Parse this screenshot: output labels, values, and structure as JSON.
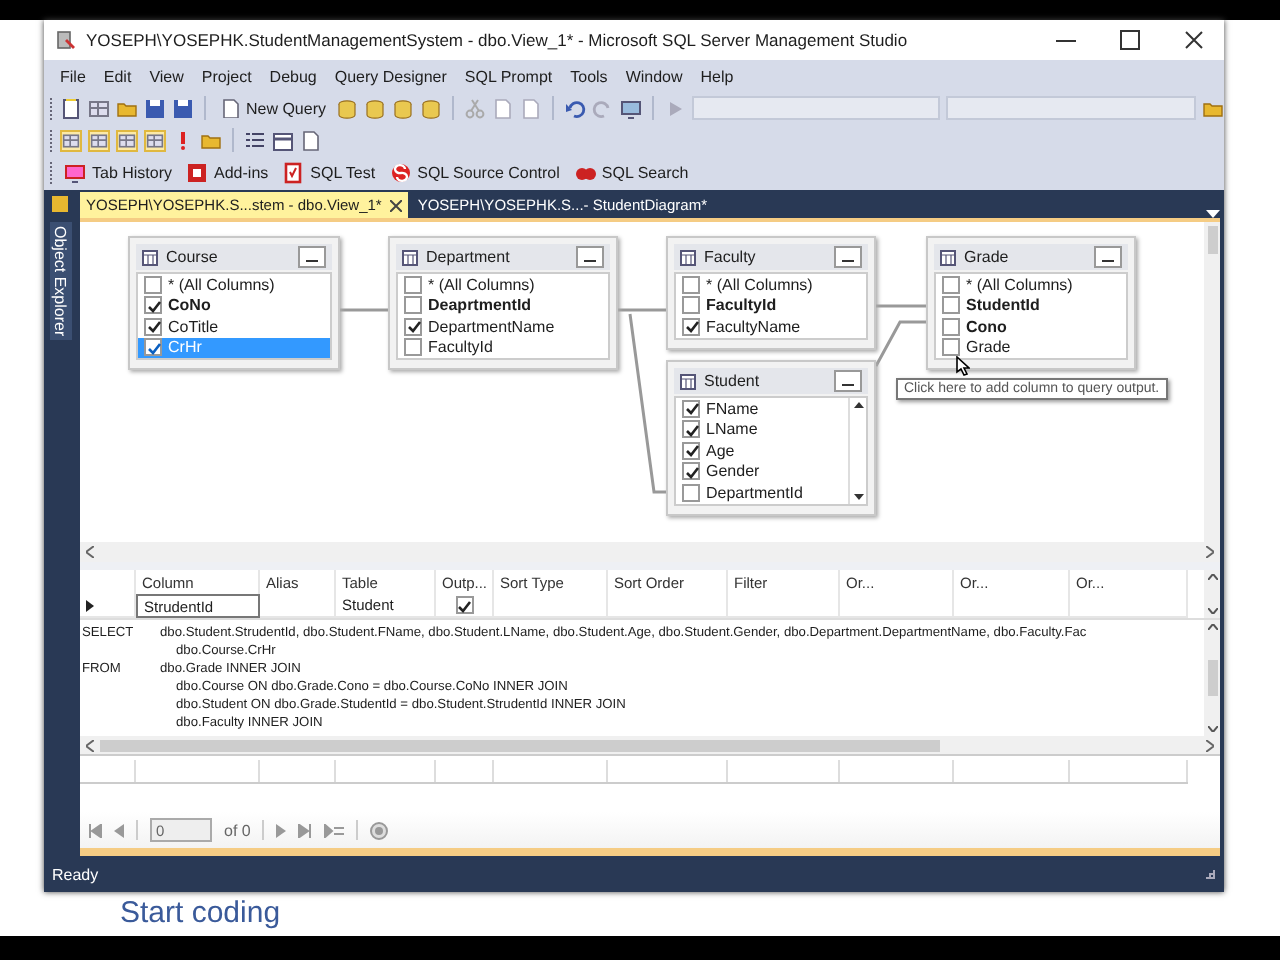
{
  "window": {
    "title": "YOSEPH\\YOSEPHK.StudentManagementSystem - dbo.View_1* - Microsoft SQL Server Management Studio"
  },
  "menu": [
    "File",
    "Edit",
    "View",
    "Project",
    "Debug",
    "Query Designer",
    "SQL Prompt",
    "Tools",
    "Window",
    "Help"
  ],
  "toolbar": {
    "new_query": "New Query"
  },
  "addin_toolbar": [
    "Tab History",
    "Add-ins",
    "SQL Test",
    "SQL Source Control",
    "SQL Search"
  ],
  "side_panel": {
    "label": "Object Explorer"
  },
  "tabs": [
    {
      "label": "YOSEPH\\YOSEPHK.S...stem - dbo.View_1*",
      "selected": true
    },
    {
      "label": "YOSEPH\\YOSEPHK.S...- StudentDiagram*",
      "selected": false
    }
  ],
  "diagram": {
    "tables": [
      {
        "name": "Course",
        "columns": [
          {
            "name": "* (All Columns)",
            "checked": false,
            "key": false,
            "selected": false
          },
          {
            "name": "CoNo",
            "checked": true,
            "key": true,
            "selected": false
          },
          {
            "name": "CoTitle",
            "checked": true,
            "key": false,
            "selected": false
          },
          {
            "name": "CrHr",
            "checked": true,
            "key": false,
            "selected": true
          }
        ]
      },
      {
        "name": "Department",
        "columns": [
          {
            "name": "* (All Columns)",
            "checked": false,
            "key": false,
            "selected": false
          },
          {
            "name": "DeaprtmentId",
            "checked": false,
            "key": true,
            "selected": false
          },
          {
            "name": "DepartmentName",
            "checked": true,
            "key": false,
            "selected": false
          },
          {
            "name": "FacultyId",
            "checked": false,
            "key": false,
            "selected": false
          }
        ]
      },
      {
        "name": "Faculty",
        "columns": [
          {
            "name": "* (All Columns)",
            "checked": false,
            "key": false,
            "selected": false
          },
          {
            "name": "FacultyId",
            "checked": false,
            "key": true,
            "selected": false
          },
          {
            "name": "FacultyName",
            "checked": true,
            "key": false,
            "selected": false
          }
        ]
      },
      {
        "name": "Student",
        "columns": [
          {
            "name": "FName",
            "checked": true,
            "key": false,
            "selected": false
          },
          {
            "name": "LName",
            "checked": true,
            "key": false,
            "selected": false
          },
          {
            "name": "Age",
            "checked": true,
            "key": false,
            "selected": false
          },
          {
            "name": "Gender",
            "checked": true,
            "key": false,
            "selected": false
          },
          {
            "name": "DepartmentId",
            "checked": false,
            "key": false,
            "selected": false
          }
        ]
      },
      {
        "name": "Grade",
        "columns": [
          {
            "name": "* (All Columns)",
            "checked": false,
            "key": false,
            "selected": false
          },
          {
            "name": "StudentId",
            "checked": false,
            "key": true,
            "selected": false
          },
          {
            "name": "Cono",
            "checked": false,
            "key": true,
            "selected": false
          },
          {
            "name": "Grade",
            "checked": false,
            "key": false,
            "selected": false
          }
        ]
      }
    ],
    "tooltip": "Click here to add column to query output."
  },
  "criteria": {
    "columns": [
      "Column",
      "Alias",
      "Table",
      "Outp...",
      "Sort Type",
      "Sort Order",
      "Filter",
      "Or...",
      "Or...",
      "Or..."
    ],
    "rows": [
      {
        "column": "StrudentId",
        "table": "Student",
        "output": true
      }
    ]
  },
  "sql": [
    {
      "kind": "clause",
      "keyword": "SELECT",
      "text": "dbo.Student.StrudentId, dbo.Student.FName, dbo.Student.LName, dbo.Student.Age, dbo.Student.Gender, dbo.Department.DepartmentName, dbo.Faculty.Fac"
    },
    {
      "kind": "continuation",
      "text": "dbo.Course.CrHr"
    },
    {
      "kind": "clause",
      "keyword": "FROM",
      "text": "dbo.Grade INNER JOIN"
    },
    {
      "kind": "continuation",
      "text": "dbo.Course ON dbo.Grade.Cono = dbo.Course.CoNo INNER JOIN"
    },
    {
      "kind": "continuation",
      "text": "dbo.Student ON dbo.Grade.StudentId = dbo.Student.StrudentId INNER JOIN"
    },
    {
      "kind": "continuation",
      "text": "dbo.Faculty INNER JOIN"
    }
  ],
  "results": {
    "page": "0",
    "of": "of 0"
  },
  "status_bar": "Ready",
  "backdrop": {
    "text": "Start coding"
  }
}
